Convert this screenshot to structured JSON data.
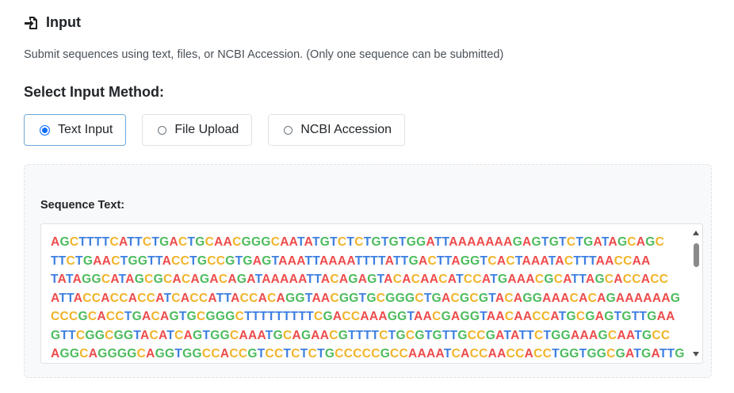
{
  "header": {
    "icon": "file-import-icon",
    "title": "Input"
  },
  "subtitle": "Submit sequences using text, files, or NCBI Accession. (Only one sequence can be submitted)",
  "method": {
    "label": "Select Input Method:",
    "options": [
      {
        "label": "Text Input",
        "selected": true
      },
      {
        "label": "File Upload",
        "selected": false
      },
      {
        "label": "NCBI Accession",
        "selected": false
      }
    ]
  },
  "sequence": {
    "label": "Sequence Text:",
    "lines": [
      "AGCTTTTCATTCTGACTGCAACGGGCAATATGTCTCTGTGTGGATTAAAAAAAGAGTGTCTGATAGCAGC",
      "TTCTGAACTGGTTACCTGCCGTGAGTAAATTAAAATTTTATTGACTTAGGTCACTAAATACTTTAACCAA",
      "TATAGGCATAGCGCACAGACAGATAAAAATTACAGAGTACACAACATCCATGAAACGCATTAGCACCACC",
      "ATTACCACCACCATCACCATTACCACAGGTAACGGTGCGGGCTGACGCGTACAGGAAACACAGAAAAAAG",
      "CCCGCACCTGACAGTGCGGGCTTTTTTTTTCGACCAAAGGTAACGAGGTAACAACCATGCGAGTGTTGAA",
      "GTTCGGCGGTACATCAGTGGCAAATGCAGAACGTTTTCTGCGTGTTGCCGATATTCTGGAAAGCAATGCC",
      "AGGCAGGGGCAGGTGGCCACCGTCCTCTCTGCCCCCGCCAAAATCACCAACCACCTGGTGGCGATGATTG"
    ],
    "nucleotide_colors": {
      "A": "#ee4b4b",
      "C": "#f0b429",
      "G": "#4cbb5c",
      "T": "#3d7fe0"
    }
  }
}
